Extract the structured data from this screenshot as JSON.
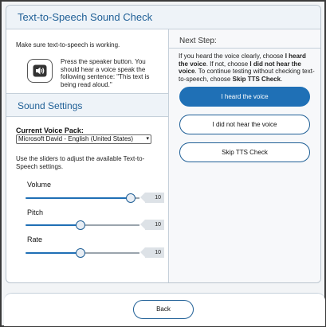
{
  "card": {
    "title": "Text-to-Speech Sound Check"
  },
  "left": {
    "intro": "Make sure text-to-speech is working.",
    "speaker_instruction": "Press the speaker button. You should hear a voice speak the following sentence: \"This text is being read aloud.\"",
    "speaker_icon": "speaker-icon"
  },
  "sound_settings": {
    "title": "Sound Settings",
    "voice_pack_label": "Current Voice Pack:",
    "voice_pack_value": "Microsoft David - English (United States)",
    "slider_hint": "Use the sliders to adjust the available Text-to-Speech settings.",
    "sliders": [
      {
        "label": "Volume",
        "value": "10",
        "level": 0.92
      },
      {
        "label": "Pitch",
        "value": "10",
        "level": 0.48
      },
      {
        "label": "Rate",
        "value": "10",
        "level": 0.48
      }
    ]
  },
  "next": {
    "label": "Next Step:",
    "buttons": {
      "heard": "I heard the voice",
      "not_heard": "I did not hear the voice",
      "skip": "Skip TTS Check"
    }
  },
  "footer": {
    "back": "Back"
  },
  "colors": {
    "accent": "#1f70b6",
    "header_bg": "#eef3f8"
  }
}
